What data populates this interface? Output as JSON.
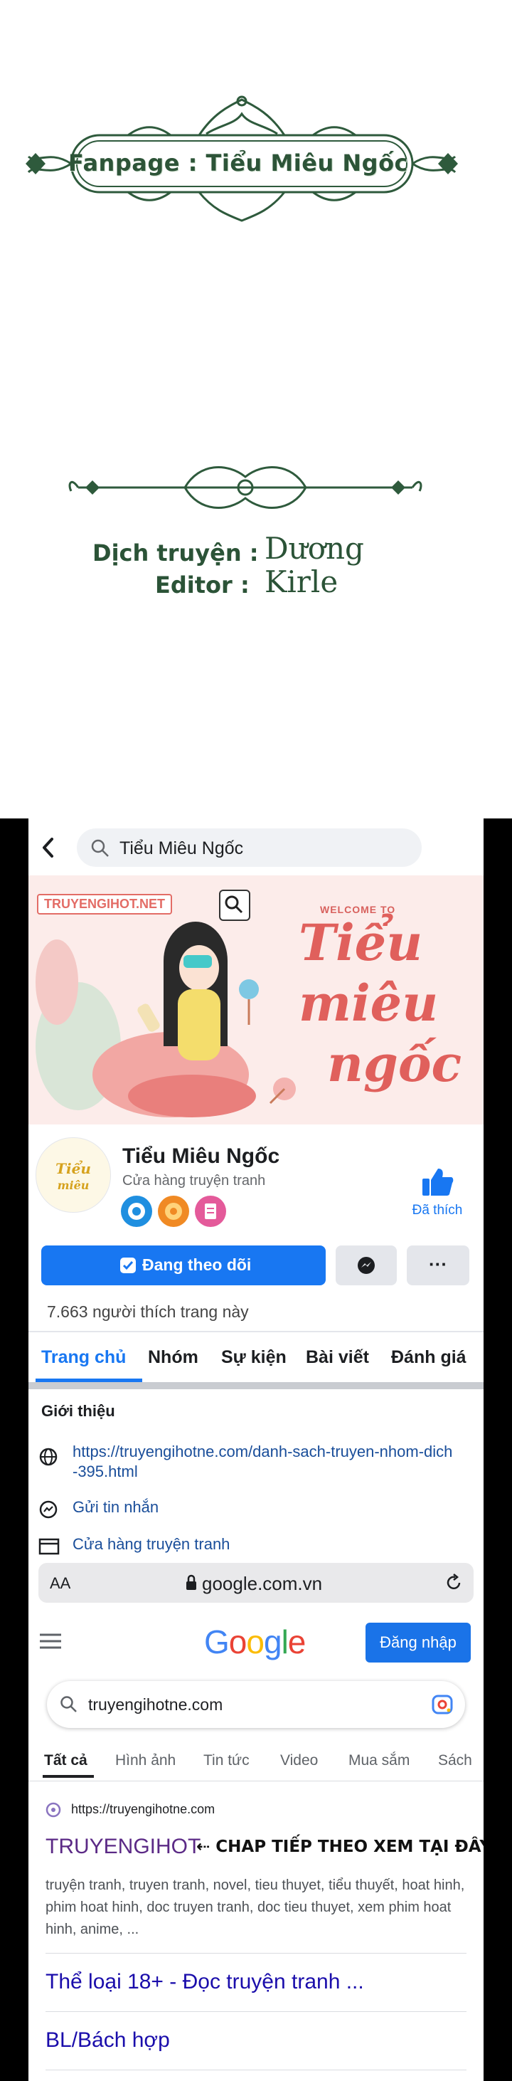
{
  "credits": {
    "fanpage": "Fanpage : Tiểu Miêu Ngốc",
    "translator_label": "Dịch truyện :",
    "translator_name": "Dương",
    "editor_label": "Editor :",
    "editor_name": "Kirle"
  },
  "facebook": {
    "search_value": "Tiểu Miêu Ngốc",
    "cover": {
      "watermark": "TRUYENGIHOT.NET",
      "welcome": "WELCOME TO",
      "title_lines": [
        "Tiểu",
        "miêu",
        "ngốc"
      ]
    },
    "page": {
      "name": "Tiểu Miêu Ngốc",
      "category": "Cửa hàng truyện tranh",
      "liked_label": "Đã thích",
      "following_button": "Đang theo dõi",
      "more_label": "···",
      "likes_text": "7.663 người thích trang này"
    },
    "tabs": [
      "Trang chủ",
      "Nhóm",
      "Sự kiện",
      "Bài viết",
      "Đánh giá"
    ],
    "intro": {
      "heading": "Giới thiệu",
      "website": "https://truyengihotne.com/danh-sach-truyen-nhom-dich-395.html",
      "message": "Gửi tin nhắn",
      "shop": "Cửa hàng truyện tranh"
    }
  },
  "browser": {
    "aa_label": "AA",
    "address": "google.com.vn"
  },
  "google": {
    "logo": "Google",
    "signin_button": "Đăng nhập",
    "query": "truyengihotne.com",
    "tabs": [
      "Tất cả",
      "Hình ảnh",
      "Tin tức",
      "Video",
      "Mua sắm",
      "Sách"
    ],
    "result": {
      "url": "https://truyengihotne.com",
      "title": "TRUYENGIHOT",
      "annotation": "⇠ CHAP TIẾP THEO XEM TẠI ĐÂY NHA",
      "snippet": "truyện tranh, truyen tranh, novel, tieu thuyet, tiểu thuyết, hoat hinh, phim hoat hinh, doc truyen tranh, doc tieu thuyet, xem phim hoat hinh, anime, ...",
      "sublinks": [
        "Thể loại 18+ - Đọc truyện tranh ...",
        "BL/Bách hợp"
      ]
    }
  },
  "colors": {
    "fb_blue": "#1877f2",
    "google_blue": "#4285f4",
    "google_red": "#ea4335",
    "google_yellow": "#fbbc05",
    "google_green": "#34a853",
    "ornament_green": "#2e5a3c",
    "result_purple": "#5b2a86"
  }
}
